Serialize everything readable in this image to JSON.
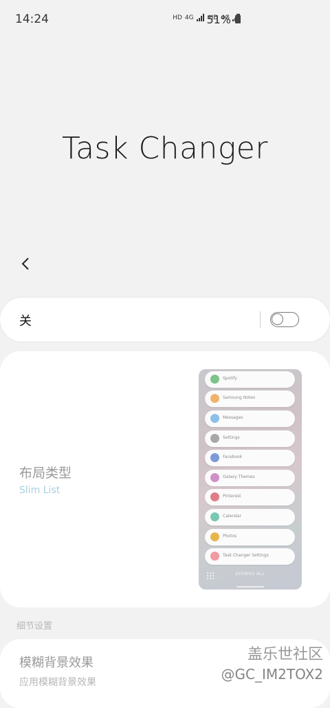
{
  "status_bar": {
    "time": "14:24",
    "hd1": "HD",
    "net1": "4G",
    "hd2": "HD",
    "net2": "4G",
    "battery": "51%"
  },
  "page": {
    "title": "Task Changer"
  },
  "switch_row": {
    "label": "关",
    "toggle_on": false
  },
  "layout": {
    "title": "布局类型",
    "value": "Slim List",
    "value_color": "#a9cfe0",
    "preview_items": [
      {
        "label": "Spotify",
        "icon_color": "#7cc48a"
      },
      {
        "label": "Samsung Notes",
        "icon_color": "#f0b36b"
      },
      {
        "label": "Messages",
        "icon_color": "#8cc0e8"
      },
      {
        "label": "Settings",
        "icon_color": "#a8a8a8"
      },
      {
        "label": "Facebook",
        "icon_color": "#7b9ad6"
      },
      {
        "label": "Galaxy Themes",
        "icon_color": "#d08fc9"
      },
      {
        "label": "Pinterest",
        "icon_color": "#e07d86"
      },
      {
        "label": "Calendar",
        "icon_color": "#79c7b3"
      },
      {
        "label": "Photos",
        "icon_color": "#e8b54a"
      },
      {
        "label": "Task Changer Settings",
        "icon_color": "#f09aa2"
      }
    ],
    "dismiss_label": "DISMISS ALL"
  },
  "details": {
    "section_header": "细节设置",
    "blur_title": "模糊背景效果",
    "blur_sub": "应用模糊背景效果"
  },
  "watermark": {
    "title": "盖乐世社区",
    "handle": "@GC_IM2TOX2"
  }
}
